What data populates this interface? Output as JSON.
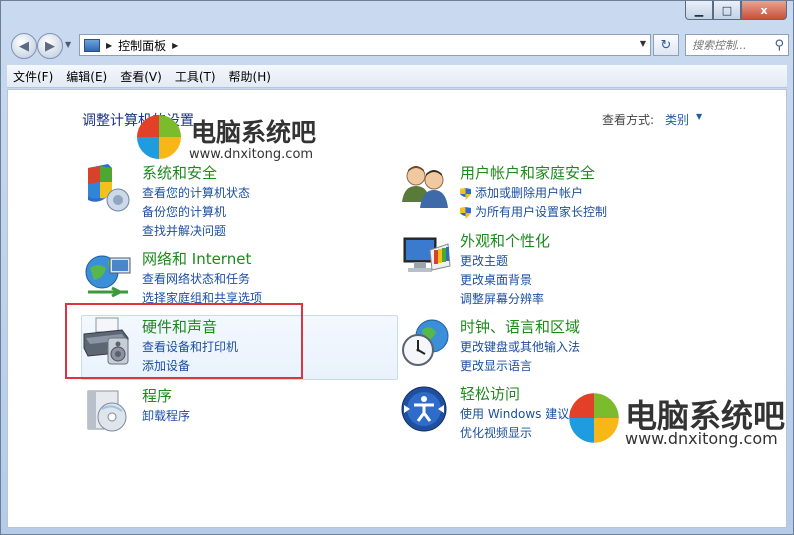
{
  "window": {
    "minimize_label": "▁",
    "maximize_label": "□",
    "close_label": "x"
  },
  "nav": {
    "address": "控制面板",
    "search_placeholder": "搜索控制..."
  },
  "menu": [
    "文件(F)",
    "编辑(E)",
    "查看(V)",
    "工具(T)",
    "帮助(H)"
  ],
  "content": {
    "page_title": "调整计算机的设置",
    "view_by_label": "查看方式:",
    "view_by_value": "类别"
  },
  "categories": [
    {
      "title": "系统和安全",
      "icon": "shield-pc-icon",
      "links": [
        "查看您的计算机状态",
        "备份您的计算机",
        "查找并解决问题"
      ]
    },
    {
      "title": "网络和 Internet",
      "icon": "globe-network-icon",
      "links": [
        "查看网络状态和任务",
        "选择家庭组和共享选项"
      ]
    },
    {
      "title": "硬件和声音",
      "icon": "printer-speaker-icon",
      "links": [
        "查看设备和打印机",
        "添加设备"
      ]
    },
    {
      "title": "程序",
      "icon": "programs-disc-icon",
      "links": [
        "卸载程序"
      ]
    },
    {
      "title": "用户帐户和家庭安全",
      "icon": "users-icon",
      "links": [
        "添加或删除用户帐户",
        "为所有用户设置家长控制"
      ]
    },
    {
      "title": "外观和个性化",
      "icon": "monitor-palette-icon",
      "links": [
        "更改主题",
        "更改桌面背景",
        "调整屏幕分辨率"
      ]
    },
    {
      "title": "时钟、语言和区域",
      "icon": "clock-globe-icon",
      "links": [
        "更改键盘或其他输入法",
        "更改显示语言"
      ]
    },
    {
      "title": "轻松访问",
      "icon": "ease-of-access-icon",
      "links": [
        "使用 Windows 建议的设置",
        "优化视频显示"
      ]
    }
  ],
  "watermark": {
    "text": "电脑系统吧",
    "url": "www.dnxitong.com"
  },
  "colors": {
    "category_title": "#1d8a1d",
    "link": "#1c4fa0",
    "highlight_box": "#d9363e"
  }
}
